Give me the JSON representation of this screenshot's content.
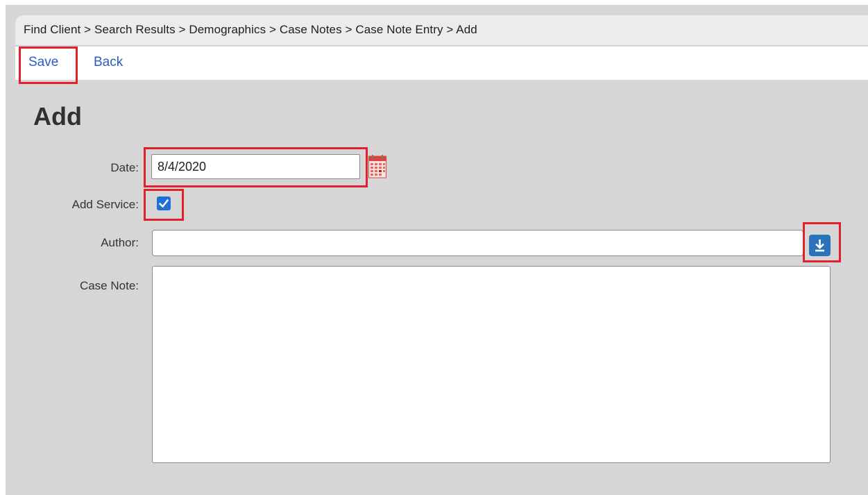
{
  "breadcrumb": "Find Client > Search Results > Demographics > Case Notes > Case Note Entry > Add",
  "toolbar": {
    "save_label": "Save",
    "back_label": "Back"
  },
  "page_title": "Add",
  "form": {
    "date": {
      "label": "Date:",
      "value": "8/4/2020"
    },
    "add_service": {
      "label": "Add Service:",
      "checked": true
    },
    "author": {
      "label": "Author:",
      "value": ""
    },
    "case_note": {
      "label": "Case Note:",
      "value": ""
    }
  },
  "icons": {
    "calendar": "calendar-icon",
    "checkmark": "checkmark-icon",
    "download": "download-arrow-icon"
  },
  "colors": {
    "highlight": "#e2202c",
    "link": "#2c5bbf",
    "checkbox": "#1f6fd6",
    "download_button": "#2a73ba",
    "panel_bg": "#d6d6d6"
  }
}
